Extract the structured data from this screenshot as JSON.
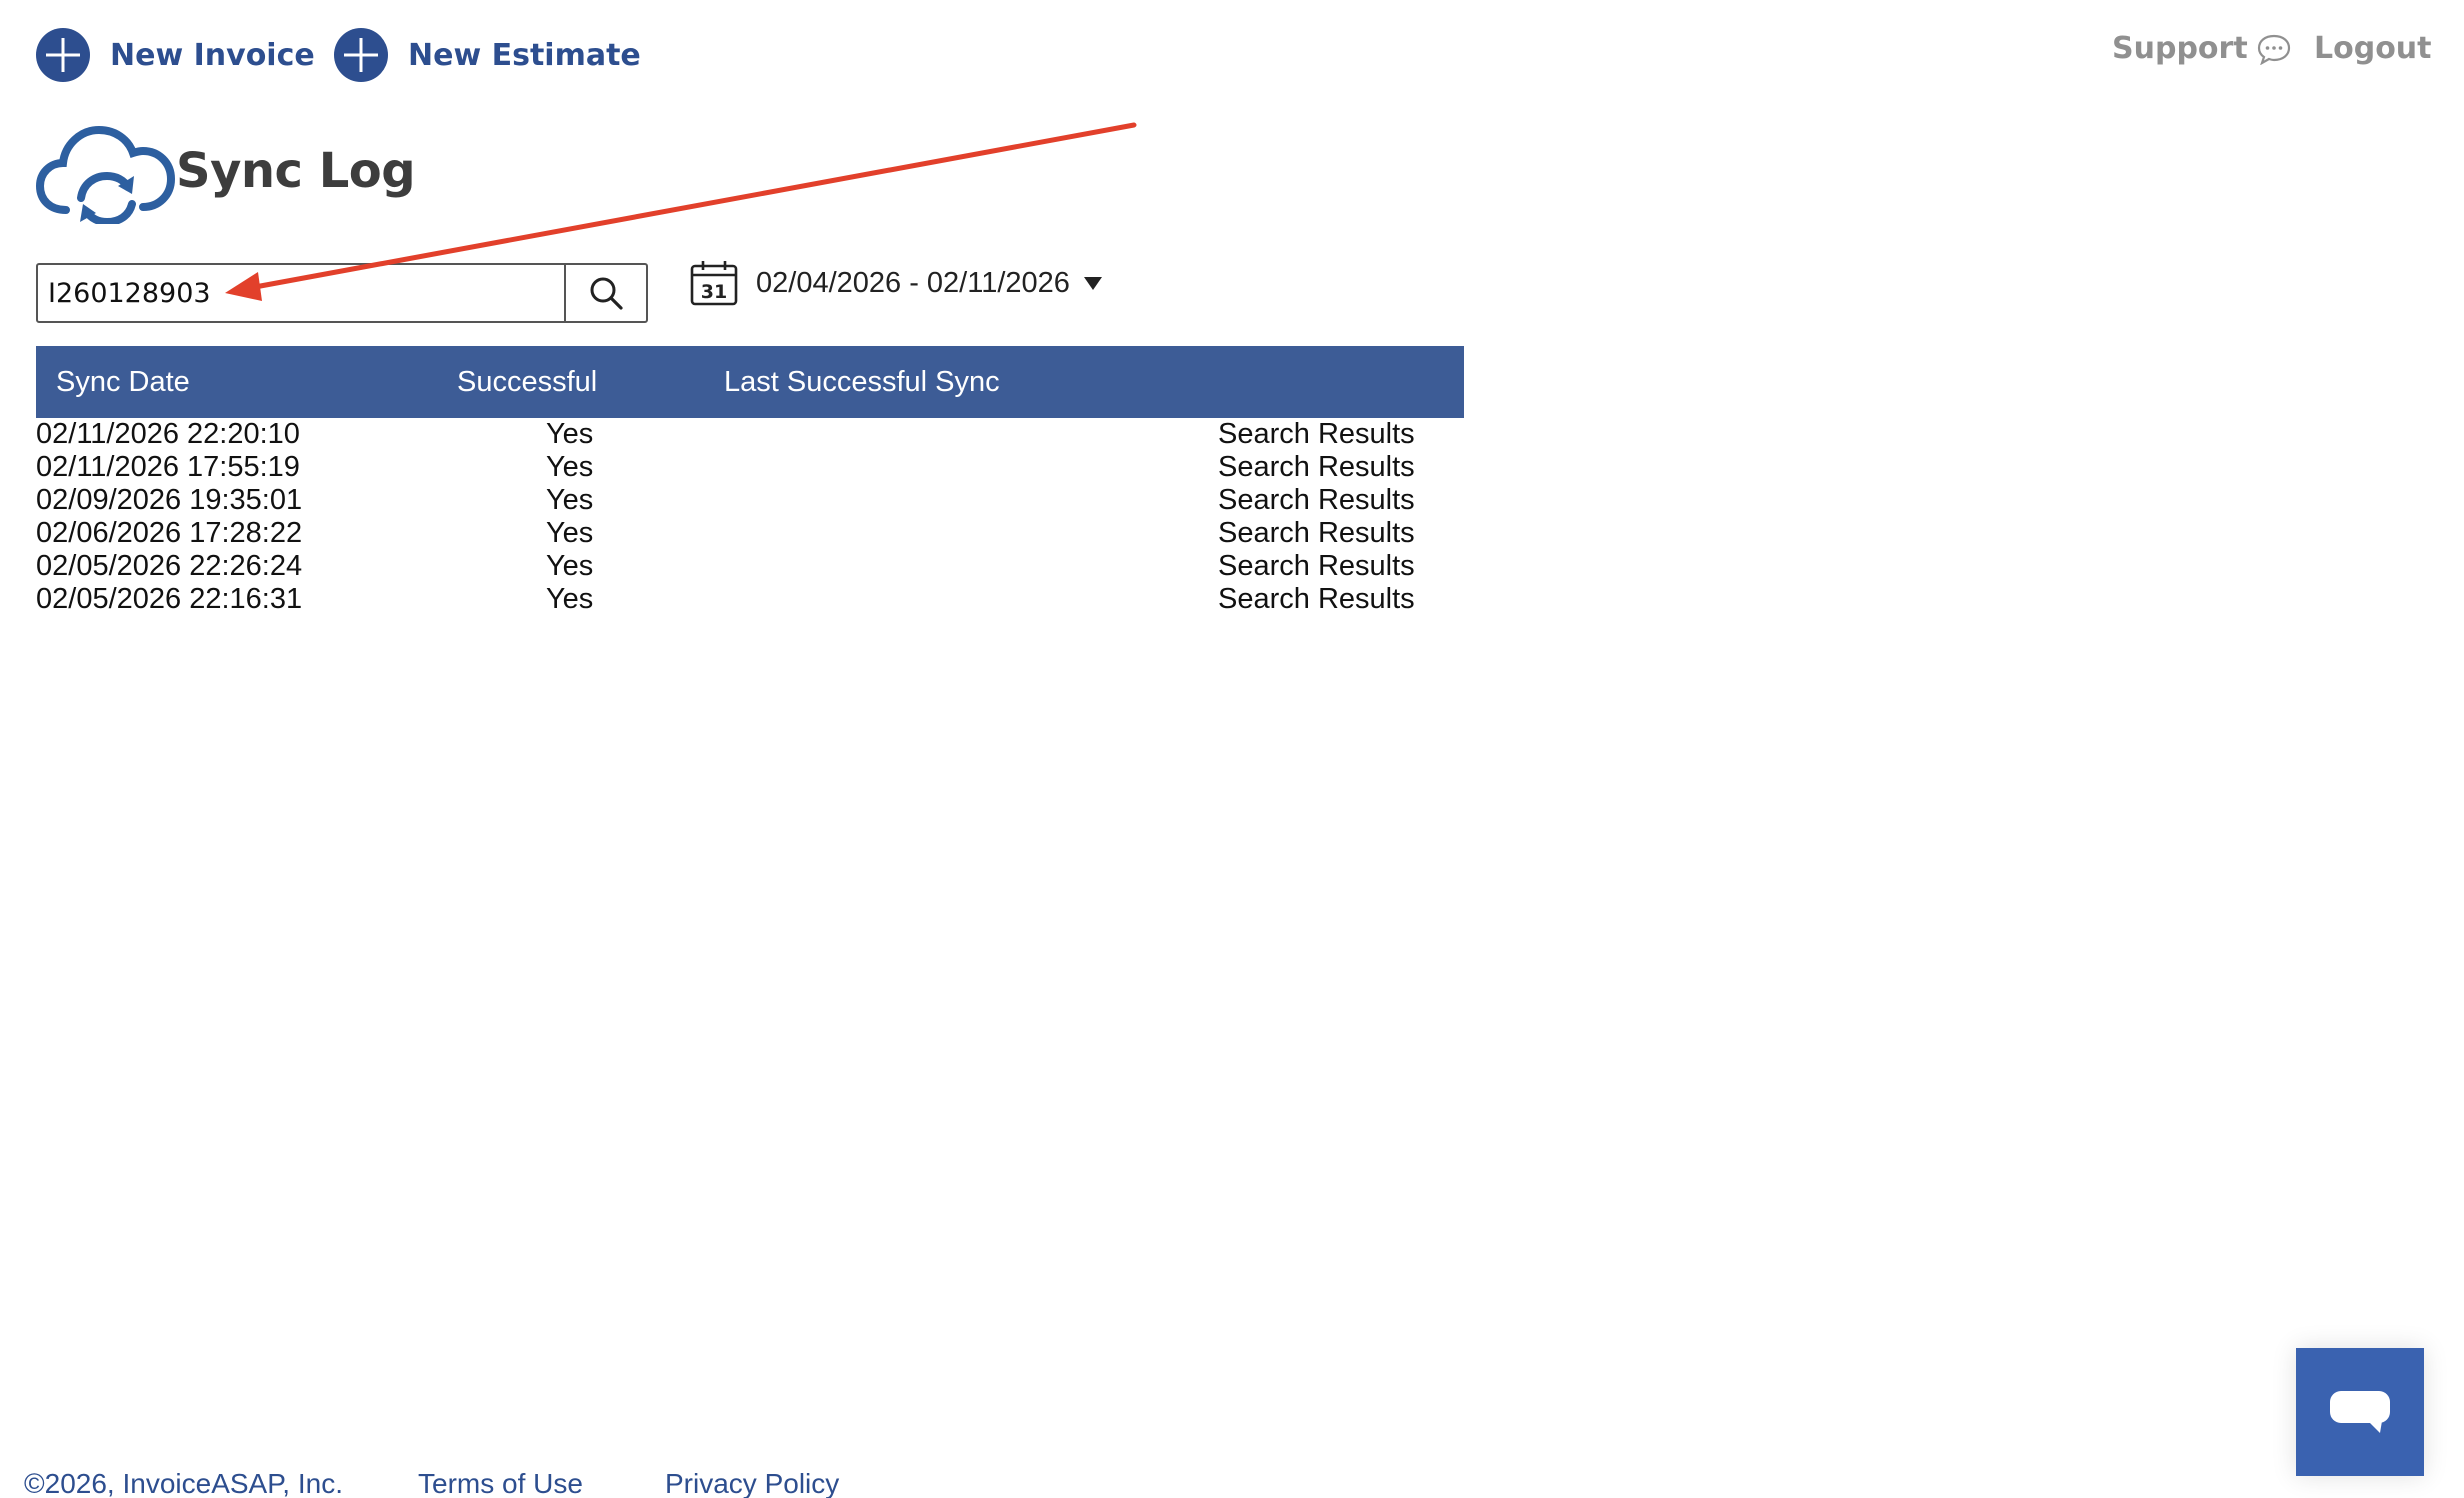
{
  "nav": {
    "new_invoice": "New Invoice",
    "new_estimate": "New Estimate",
    "support": "Support",
    "logout": "Logout"
  },
  "page": {
    "title": "Sync Log"
  },
  "search": {
    "value": "I260128903",
    "icon": "search-icon"
  },
  "date_filter": {
    "range": "02/04/2026 - 02/11/2026",
    "calendar_day": "31"
  },
  "table": {
    "headers": [
      "Sync Date",
      "Successful",
      "Last Successful Sync"
    ],
    "rows": [
      {
        "date": "02/11/2026 22:20:10",
        "successful": "Yes",
        "link": "Search Results"
      },
      {
        "date": "02/11/2026 17:55:19",
        "successful": "Yes",
        "link": "Search Results"
      },
      {
        "date": "02/09/2026 19:35:01",
        "successful": "Yes",
        "link": "Search Results"
      },
      {
        "date": "02/06/2026 17:28:22",
        "successful": "Yes",
        "link": "Search Results"
      },
      {
        "date": "02/05/2026 22:26:24",
        "successful": "Yes",
        "link": "Search Results"
      },
      {
        "date": "02/05/2026 22:16:31",
        "successful": "Yes",
        "link": "Search Results"
      }
    ]
  },
  "footer": {
    "copyright": "©2026, InvoiceASAP, Inc.",
    "terms": "Terms of Use",
    "privacy": "Privacy Policy"
  },
  "colors": {
    "brand": "#2d4e8f",
    "header_bg": "#3d5c96",
    "chat_bg": "#3a62b0",
    "annotation": "#e2402b",
    "muted": "#909090"
  }
}
